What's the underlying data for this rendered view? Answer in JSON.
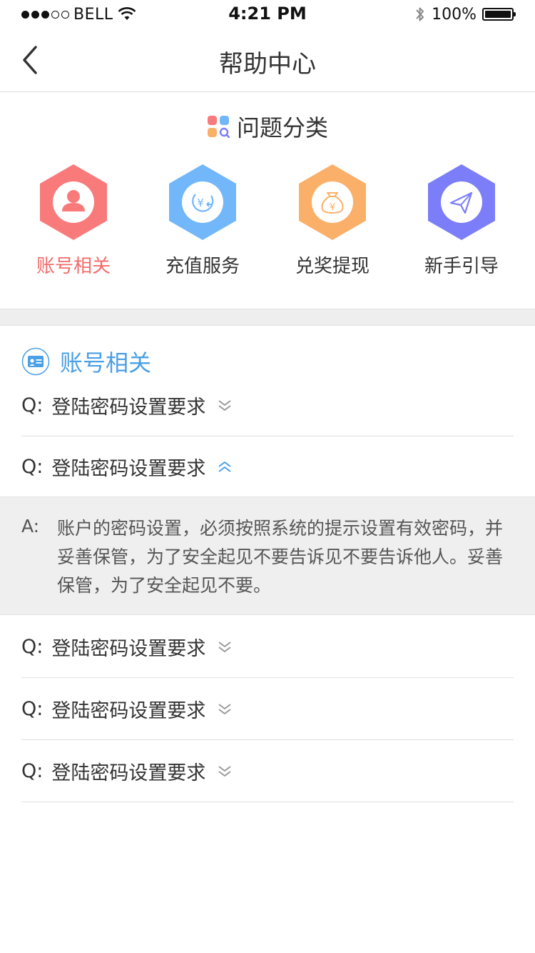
{
  "status_bar": {
    "carrier": "BELL",
    "time": "4:21 PM",
    "battery": "100%",
    "signal_strength": 3
  },
  "nav": {
    "title": "帮助中心"
  },
  "categories": {
    "title": "问题分类",
    "items": [
      {
        "label": "账号相关",
        "icon": "user-icon",
        "color": "#f97a7a",
        "active": true
      },
      {
        "label": "充值服务",
        "icon": "yuan-exchange-icon",
        "color": "#72b7f9"
      },
      {
        "label": "兑奖提现",
        "icon": "money-bag-icon",
        "color": "#fbb06a"
      },
      {
        "label": "新手引导",
        "icon": "paper-plane-icon",
        "color": "#7b7ef8"
      }
    ]
  },
  "faq": {
    "section_title": "账号相关",
    "q_prefix": "Q:",
    "a_prefix": "A:",
    "items": [
      {
        "question": "登陆密码设置要求",
        "expanded": false
      },
      {
        "question": "登陆密码设置要求",
        "expanded": true
      },
      {
        "question": "登陆密码设置要求",
        "expanded": false
      },
      {
        "question": "登陆密码设置要求",
        "expanded": false
      },
      {
        "question": "登陆密码设置要求",
        "expanded": false
      }
    ],
    "answer": "账户的密码设置，必须按照系统的提示设置有效密码，并妥善保管，为了安全起见不要告诉见不要告诉他人。妥善保管，为了安全起见不要。"
  },
  "colors": {
    "accent_blue": "#4a9fe6",
    "active_red": "#f26b6b"
  }
}
